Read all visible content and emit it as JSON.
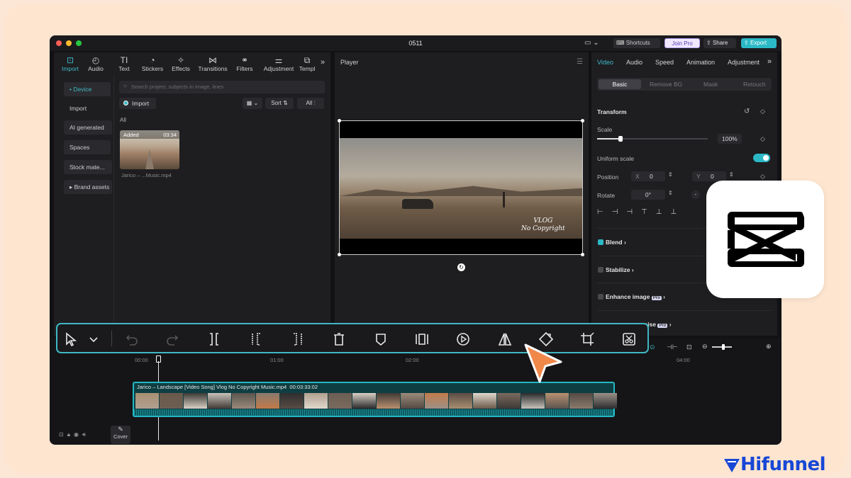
{
  "window": {
    "title": "0511"
  },
  "topbar": {
    "shortcuts": "Shortcuts",
    "join_pro": "Join Pro",
    "share": "Share",
    "export": "Export"
  },
  "toolbar": {
    "items": [
      {
        "label": "Import",
        "icon": "import-icon",
        "active": true
      },
      {
        "label": "Audio",
        "icon": "audio-icon"
      },
      {
        "label": "Text",
        "icon": "text-icon",
        "glyph": "TI"
      },
      {
        "label": "Stickers",
        "icon": "sticker-icon"
      },
      {
        "label": "Effects",
        "icon": "effects-icon"
      },
      {
        "label": "Transitions",
        "icon": "transitions-icon"
      },
      {
        "label": "Filters",
        "icon": "filters-icon"
      },
      {
        "label": "Adjustment",
        "icon": "adjustment-icon"
      },
      {
        "label": "Templ",
        "icon": "templates-icon"
      }
    ]
  },
  "sidebar": {
    "items": [
      "• Device",
      "Import",
      "AI generated",
      "Spaces",
      "Stock mate...",
      "▸ Brand assets"
    ]
  },
  "media": {
    "search_placeholder": "Search project, subjects in image, lines",
    "import_label": "Import",
    "sort_label": "Sort",
    "all_filter": "All",
    "section_label": "All",
    "item": {
      "badge": "Added",
      "duration": "03:34",
      "name": "Jarico – ...Music.mp4"
    }
  },
  "player": {
    "title": "Player",
    "overlay_line1": "VLOG",
    "overlay_line2": "No Copyright"
  },
  "right_panel": {
    "tabs": [
      "Video",
      "Audio",
      "Speed",
      "Animation",
      "Adjustment"
    ],
    "subtabs": [
      "Basic",
      "Remove BG",
      "Mask",
      "Retouch"
    ],
    "transform": "Transform",
    "scale": "Scale",
    "scale_value": "100%",
    "uniform_scale": "Uniform scale",
    "position": "Position",
    "pos_x_label": "X",
    "pos_x": "0",
    "pos_y_label": "Y",
    "pos_y": "0",
    "rotate": "Rotate",
    "rotate_value": "0°",
    "blend": "Blend",
    "stabilize": "Stabilize",
    "enhance_image": "Enhance image",
    "pro_badge": "Pro",
    "reduce_noise": "oise"
  },
  "timeline": {
    "ticks": [
      "00:00",
      "01:00",
      "02:00",
      "04:00"
    ],
    "cover": "Cover",
    "clip_title": "Jarico – Landscape [Video Song] Vlog No Copyright Music.mp4",
    "clip_duration": "00:03:33:02"
  },
  "brand": {
    "name": "Hifunnel"
  },
  "colors": {
    "accent": "#3fb8c4",
    "cursor": "#f0884a",
    "export": "#2bb9c6"
  }
}
